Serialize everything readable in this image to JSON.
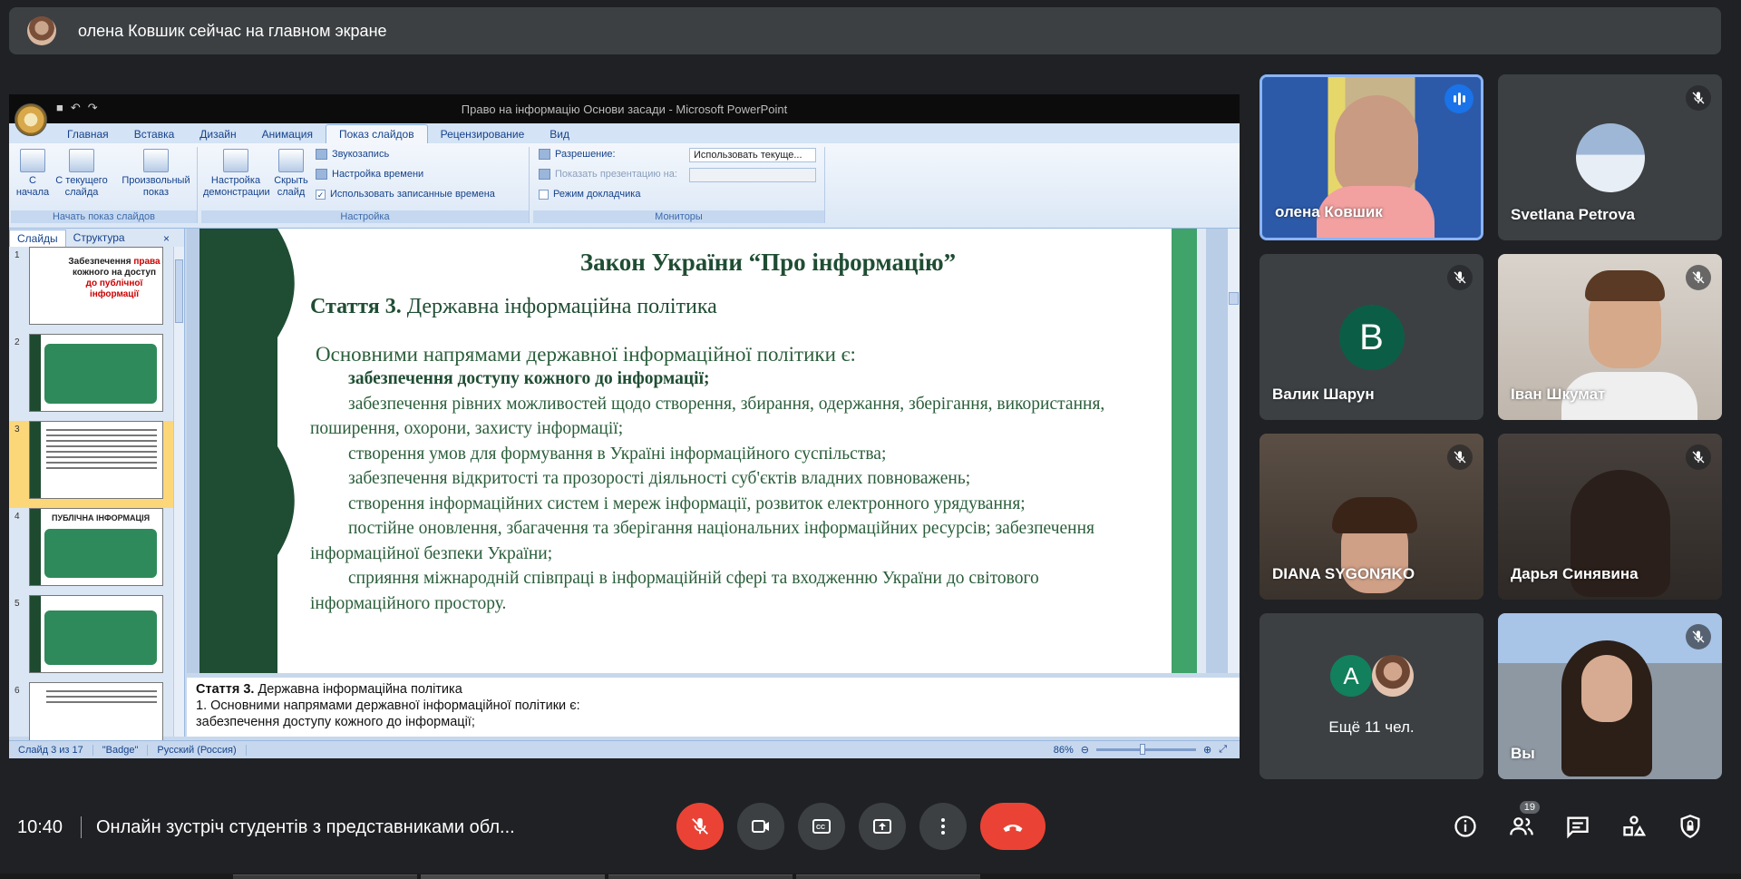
{
  "banner": {
    "text": "олена Ковшик сейчас на главном экране"
  },
  "ppt": {
    "window_title": "Право на інформацію Основи засади - Microsoft PowerPoint",
    "tabs": [
      "Главная",
      "Вставка",
      "Дизайн",
      "Анимация",
      "Показ слайдов",
      "Рецензирование",
      "Вид"
    ],
    "active_tab": "Показ слайдов",
    "ribbon": {
      "start_group": {
        "label": "Начать показ слайдов",
        "b1": "С начала",
        "b2": "С текущего слайда",
        "b3": "Произвольный показ"
      },
      "setup_group": {
        "label": "Настройка",
        "b1": "Настройка демонстрации",
        "b2": "Скрыть слайд",
        "r1": "Звукозапись",
        "r2": "Настройка времени",
        "r3": "Использовать записанные времена"
      },
      "monitors_group": {
        "label": "Мониторы",
        "res_label": "Разрешение:",
        "res_value": "Использовать текуще...",
        "show_label": "Показать презентацию на:",
        "presenter": "Режим докладчика"
      }
    },
    "panel_tabs": {
      "slides": "Слайды",
      "outline": "Структура",
      "close": "×"
    },
    "thumbs": [
      {
        "num": "1",
        "line1": "Забезпечення ",
        "line1_red": "права",
        "line2": "кожного на доступ",
        "line3": "до публічної інформації"
      },
      {
        "num": "2"
      },
      {
        "num": "3"
      },
      {
        "num": "4",
        "title": "ПУБЛІЧНА ІНФОРМАЦІЯ"
      },
      {
        "num": "5"
      },
      {
        "num": "6"
      }
    ],
    "slide": {
      "title": "Закон України “Про інформацію”",
      "article_bold": "Стаття 3.",
      "article_rest": " Державна інформаційна політика",
      "lead": "Основними напрямами державної інформаційної політики є:",
      "items": [
        "забезпечення доступу кожного до інформації;",
        "забезпечення рівних можливостей щодо створення, збирання, одержання, зберігання, використання, поширення, охорони, захисту інформації;",
        "створення умов для формування в Україні інформаційного суспільства;",
        "забезпечення відкритості та прозорості діяльності суб'єктів владних повноважень;",
        "створення інформаційних систем і мереж інформації, розвиток електронного урядування;",
        "постійне оновлення, збагачення та зберігання національних інформаційних ресурсів; забезпечення інформаційної безпеки України;",
        "сприяння міжнародній співпраці в інформаційній сфері та входженню України до світового інформаційного простору."
      ]
    },
    "notes": {
      "line1_bold": "Стаття 3.",
      "line1_rest": " Державна інформаційна політика",
      "line2": "1. Основними напрямами державної інформаційної політики є:",
      "line3": "забезпечення доступу кожного до інформації;"
    },
    "status": {
      "slide": "Слайд 3 из 17",
      "theme": "\"Badge\"",
      "lang": "Русский (Россия)",
      "zoom": "86%"
    }
  },
  "participants": [
    {
      "name": "олена Ковшик",
      "speaking": true
    },
    {
      "name": "Svetlana Petrova",
      "muted": true
    },
    {
      "name": "Валик Шарун",
      "letter": "B",
      "color": "#0b5e45",
      "muted": true
    },
    {
      "name": "Іван Шкумат",
      "muted": true
    },
    {
      "name": "DIANA SYGONЯKO",
      "muted": true
    },
    {
      "name": "Дарья Синявина",
      "muted": true
    },
    {
      "more": "Ещё 11 чел.",
      "letter": "A",
      "color": "#12805c"
    },
    {
      "name": "Вы",
      "muted": true
    }
  ],
  "meeting": {
    "time": "10:40",
    "title": "Онлайн зустріч студентів з представниками обл...",
    "people_count": "19"
  },
  "colors": {
    "bg": "#202124",
    "tile": "#3c4043",
    "red": "#ea4335",
    "accent": "#8ab4f8"
  }
}
